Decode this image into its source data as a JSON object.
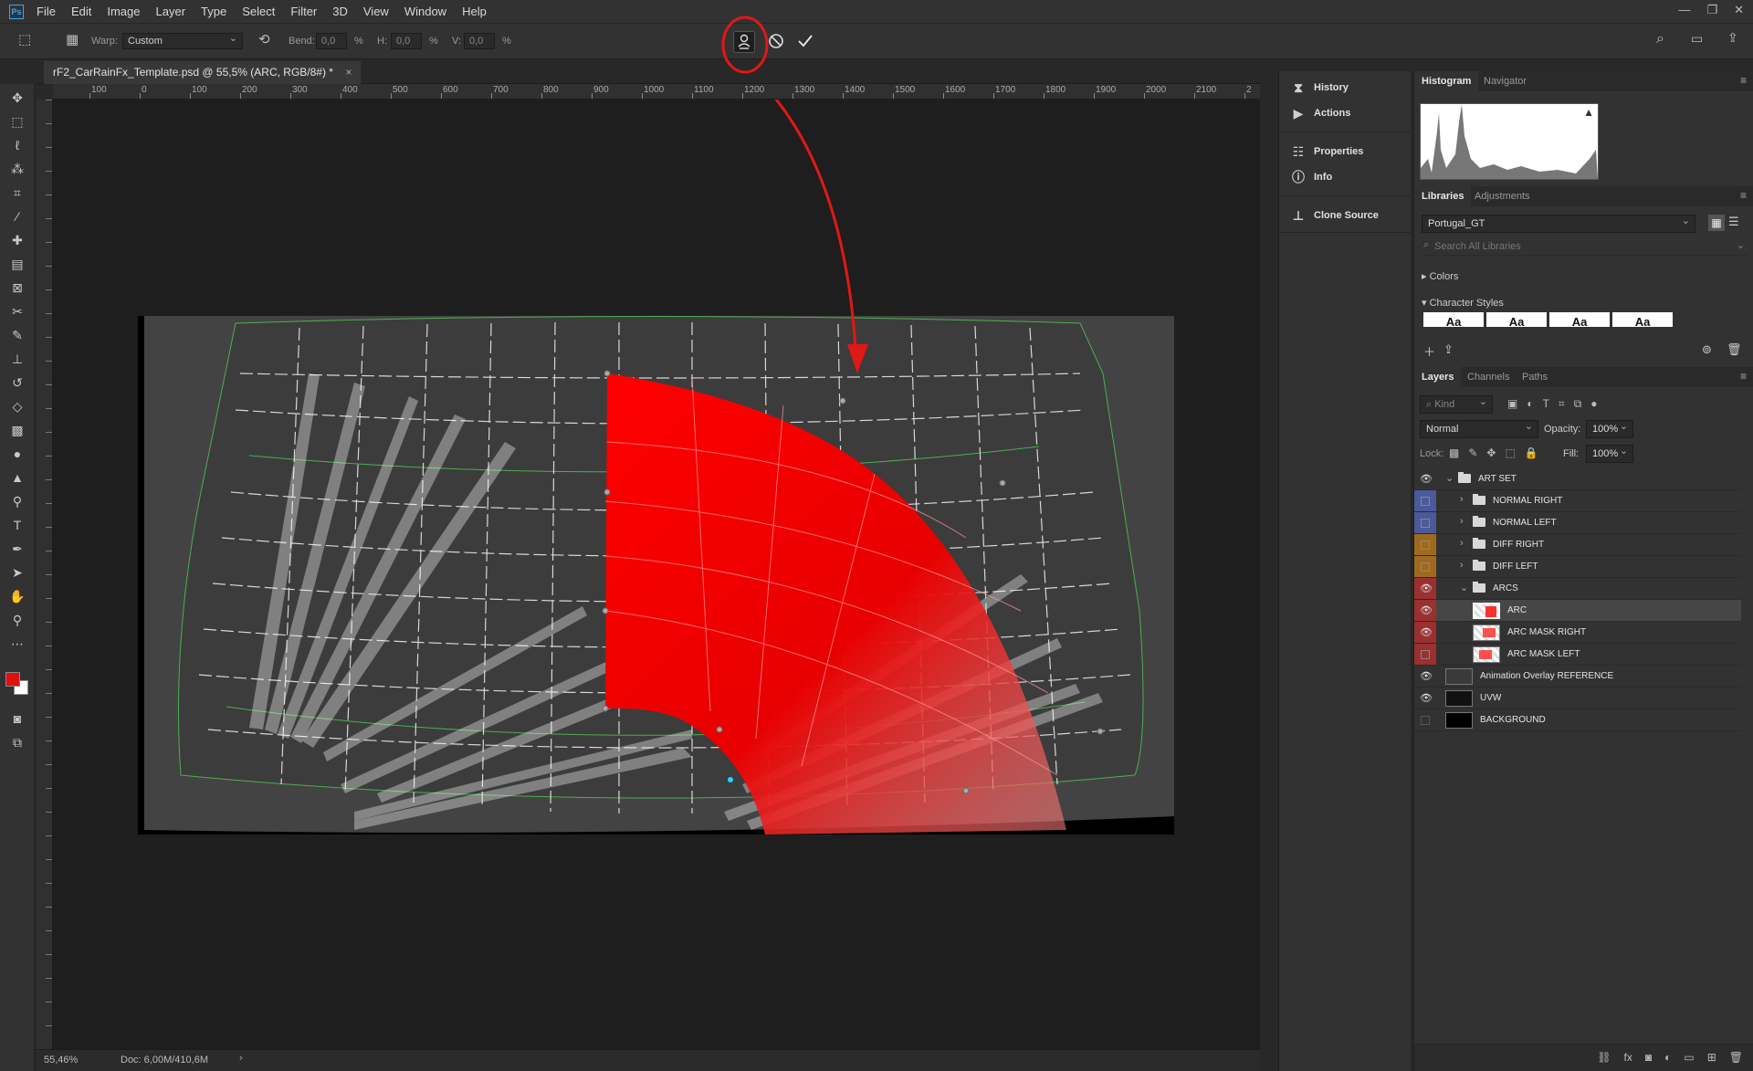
{
  "menubar": {
    "logo": "Ps",
    "items": [
      "File",
      "Edit",
      "Image",
      "Layer",
      "Type",
      "Select",
      "Filter",
      "3D",
      "View",
      "Window",
      "Help"
    ],
    "window_controls": [
      "—",
      "❐",
      "✕"
    ]
  },
  "options": {
    "warp_label": "Warp:",
    "warp_value": "Custom",
    "bend_label": "Bend:",
    "bend_value": "0,0",
    "bend_unit": "%",
    "h_label": "H:",
    "h_value": "0,0",
    "h_unit": "%",
    "v_label": "V:",
    "v_value": "0,0",
    "v_unit": "%"
  },
  "document": {
    "tab_title": "rF2_CarRainFx_Template.psd @ 55,5% (ARC, RGB/8#) *",
    "close": "×"
  },
  "ruler": {
    "h_ticks": [
      "100",
      "0",
      "100",
      "200",
      "300",
      "400",
      "500",
      "600",
      "700",
      "800",
      "900",
      "1000",
      "1100",
      "1200",
      "1300",
      "1400",
      "1500",
      "1600",
      "1700",
      "1800",
      "1900",
      "2000",
      "2100",
      "2"
    ]
  },
  "status": {
    "zoom": "55,46%",
    "doc": "Doc: 6,00M/410,6M"
  },
  "panel_mid": {
    "items": [
      "History",
      "Actions",
      "Properties",
      "Info",
      "Clone Source"
    ]
  },
  "histogram": {
    "tabs": [
      "Histogram",
      "Navigator"
    ],
    "warning_icon": "warning-triangle-icon"
  },
  "libraries": {
    "tabs": [
      "Libraries",
      "Adjustments"
    ],
    "library_name": "Portugal_GT",
    "search_placeholder": "Search All Libraries",
    "sections": [
      "Colors",
      "Character Styles"
    ],
    "char_style_glyph": "Aa"
  },
  "layers": {
    "tabs": [
      "Layers",
      "Channels",
      "Paths"
    ],
    "kind_placeholder": "Kind",
    "blend_mode": "Normal",
    "opacity_label": "Opacity:",
    "opacity_value": "100%",
    "lock_label": "Lock:",
    "fill_label": "Fill:",
    "fill_value": "100%",
    "rows": [
      {
        "name": "ART SET",
        "color": "",
        "visible": true,
        "type": "group",
        "indent": 0,
        "open": true
      },
      {
        "name": "NORMAL RIGHT",
        "color": "#4a5a9a",
        "visible": false,
        "type": "group",
        "indent": 1,
        "open": false
      },
      {
        "name": "NORMAL LEFT",
        "color": "#4a5a9a",
        "visible": false,
        "type": "group",
        "indent": 1,
        "open": false
      },
      {
        "name": "DIFF RIGHT",
        "color": "#a06a1e",
        "visible": false,
        "type": "group",
        "indent": 1,
        "open": false
      },
      {
        "name": "DIFF LEFT",
        "color": "#a06a1e",
        "visible": false,
        "type": "group",
        "indent": 1,
        "open": false
      },
      {
        "name": "ARCS",
        "color": "#9a3030",
        "visible": true,
        "type": "group",
        "indent": 1,
        "open": true
      },
      {
        "name": "ARC",
        "color": "#9a3030",
        "visible": true,
        "type": "layer",
        "indent": 2,
        "selected": true
      },
      {
        "name": "ARC MASK RIGHT",
        "color": "#9a3030",
        "visible": true,
        "type": "layer",
        "indent": 2
      },
      {
        "name": "ARC MASK LEFT",
        "color": "#9a3030",
        "visible": false,
        "type": "layer",
        "indent": 2
      },
      {
        "name": "Animation Overlay REFERENCE",
        "color": "",
        "visible": true,
        "type": "layer",
        "indent": 0
      },
      {
        "name": "UVW",
        "color": "",
        "visible": true,
        "type": "layer",
        "indent": 0
      },
      {
        "name": "BACKGROUND",
        "color": "",
        "visible": false,
        "type": "layer",
        "indent": 0
      }
    ]
  },
  "colors": {
    "foreground": "#e01010",
    "background": "#ffffff",
    "annotation": "#e01818",
    "warp_fill": "#ff0000"
  }
}
